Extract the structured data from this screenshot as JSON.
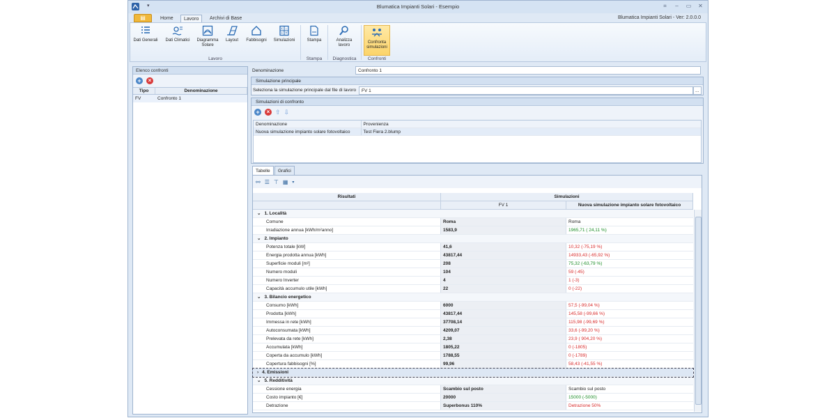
{
  "window": {
    "title": "Blumatica Impianti Solari - Esempio",
    "version": "Blumatica Impianti Solari - Ver: 2.0.0.0"
  },
  "ribbon_tabs": [
    "Home",
    "Lavoro",
    "Archivi di Base"
  ],
  "ribbon": {
    "buttons": [
      {
        "label": "Dati Generali",
        "icon": "list-icon"
      },
      {
        "label": "Dati Climatici",
        "icon": "sun-climate-icon"
      },
      {
        "label": "Diagramma Solare",
        "icon": "solar-diagram-icon"
      },
      {
        "label": "Layout",
        "icon": "panel-layout-icon"
      },
      {
        "label": "Fabbisogni",
        "icon": "house-icon"
      },
      {
        "label": "Simulazioni",
        "icon": "calculator-icon"
      },
      {
        "label": "Stampa",
        "icon": "print-icon"
      },
      {
        "label": "Analizza lavoro",
        "icon": "analyze-icon"
      },
      {
        "label": "Confronta simulazioni",
        "icon": "compare-icon"
      }
    ],
    "groups": [
      "Lavoro",
      "Stampa",
      "Diagnostica",
      "Confronti"
    ]
  },
  "left_panel": {
    "title": "Elenco confronti",
    "columns": [
      "Tipo",
      "Denominazione"
    ],
    "rows": [
      {
        "tipo": "FV",
        "denominazione": "Confronto 1"
      }
    ]
  },
  "form": {
    "denominazione_label": "Denominazione",
    "denominazione_value": "Confronto 1",
    "sim_principale_title": "Simulazione principale",
    "sim_principale_label": "Seleziona la simulazione principale dal file di lavoro",
    "sim_principale_value": "FV 1",
    "browse": "...",
    "sim_confronto_title": "Simulazioni di confronto",
    "confronto_columns": [
      "Denominazione",
      "Provenienza"
    ],
    "confronto_rows": [
      {
        "denominazione": "Nuova simulazione impianto solare fotovoltaico",
        "provenienza": "Test Fiera 2.blump"
      }
    ]
  },
  "content_tabs": [
    "Tabelle",
    "Grafici"
  ],
  "results": {
    "header_left": "Risultati",
    "header_right": "Simulazioni",
    "col_main": "FV 1",
    "col_comp": "Nuova simulazione impianto solare fotovoltaico",
    "sections": [
      {
        "title": "1. Località",
        "expanded": true,
        "rows": [
          {
            "label": "Comune",
            "main": "Roma",
            "comp": "Roma",
            "status": "neutral"
          },
          {
            "label": "Irradiazione annua [kWh/m²anno]",
            "main": "1583,9",
            "comp": "1965,71 ( 24,11 %)",
            "status": "up"
          }
        ]
      },
      {
        "title": "2. Impianto",
        "expanded": true,
        "rows": [
          {
            "label": "Potenza totale [kW]",
            "main": "41,6",
            "comp": "10,32 (-75,19 %)",
            "status": "down"
          },
          {
            "label": "Energia prodotta annua [kWh]",
            "main": "43817,44",
            "comp": "14933,43 (-65,92 %)",
            "status": "down"
          },
          {
            "label": "Superficie moduli [m²]",
            "main": "208",
            "comp": "75,32 (-63,79 %)",
            "status": "up"
          },
          {
            "label": "Numero moduli",
            "main": "104",
            "comp": "59 (-45)",
            "status": "down"
          },
          {
            "label": "Numero Inverter",
            "main": "4",
            "comp": "1 (-3)",
            "status": "down"
          },
          {
            "label": "Capacità accumulo utile [kWh]",
            "main": "22",
            "comp": "0 (-22)",
            "status": "down"
          }
        ]
      },
      {
        "title": "3. Bilancio energetico",
        "expanded": true,
        "rows": [
          {
            "label": "Consumo [kWh]",
            "main": "6000",
            "comp": "57,5 (-99,04 %)",
            "status": "down"
          },
          {
            "label": "Prodotta [kWh]",
            "main": "43817,44",
            "comp": "145,58 (-99,66 %)",
            "status": "down"
          },
          {
            "label": "Immessa in rete [kWh]",
            "main": "37708,14",
            "comp": "115,98 (-99,69 %)",
            "status": "down"
          },
          {
            "label": "Autoconsumata [kWh]",
            "main": "4209,07",
            "comp": "33,6 (-99,20 %)",
            "status": "down"
          },
          {
            "label": "Prelevata da rete [kWh]",
            "main": "2,38",
            "comp": "23,9 ( 904,20 %)",
            "status": "down"
          },
          {
            "label": "Accumulata [kWh]",
            "main": "1805,22",
            "comp": "0 (-1805)",
            "status": "down"
          },
          {
            "label": "Coperta da accumulo [kWh]",
            "main": "1788,55",
            "comp": "0 (-1789)",
            "status": "down"
          },
          {
            "label": "Copertura fabbisogni [%]",
            "main": "99,96",
            "comp": "58,43 (-41,55 %)",
            "status": "down"
          }
        ]
      },
      {
        "title": "4. Emissioni",
        "expanded": false,
        "rows": []
      },
      {
        "title": "5. Redditività",
        "expanded": true,
        "rows": [
          {
            "label": "Cessione energia",
            "main": "Scambio sul posto",
            "comp": "Scambio sul posto",
            "status": "neutral"
          },
          {
            "label": "Costo impianto [€]",
            "main": "20000",
            "comp": "15000 (-5000)",
            "status": "up"
          },
          {
            "label": "Detrazione",
            "main": "Superbonus 110%",
            "comp": "Detrazione 50%",
            "status": "down"
          }
        ]
      }
    ]
  },
  "colors": {
    "accent": "#f0b83a",
    "up": "#1c8d27",
    "down": "#d82a2a",
    "panel": "#d2e0f1"
  }
}
